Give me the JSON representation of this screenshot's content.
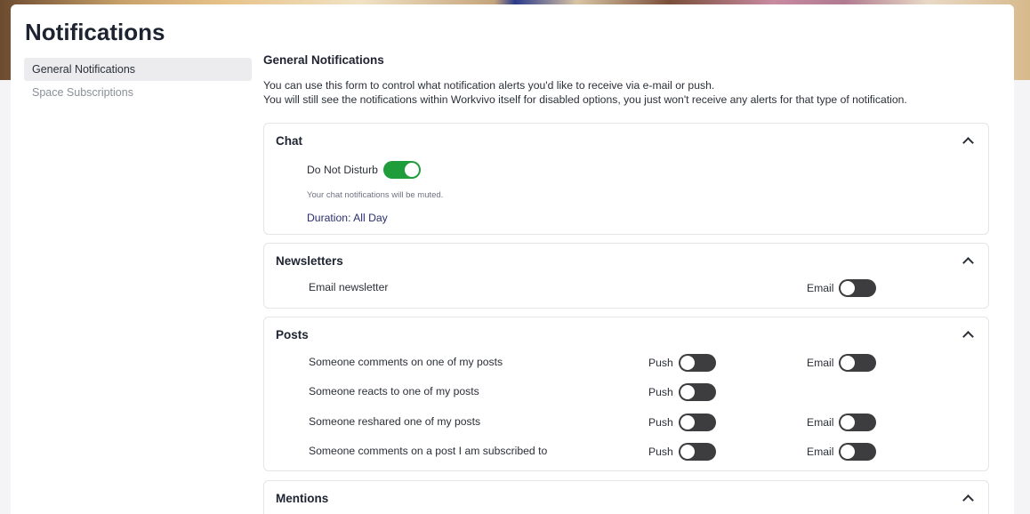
{
  "page": {
    "title": "Notifications"
  },
  "sidebar": {
    "items": [
      {
        "label": "General Notifications",
        "active": true
      },
      {
        "label": "Space Subscriptions",
        "active": false
      }
    ]
  },
  "main": {
    "heading": "General Notifications",
    "intro_line1": "You can use this form to control what notification alerts you'd like to receive via e-mail or push.",
    "intro_line2": "You will still see the notifications within Workvivo itself for disabled options, you just won't receive any alerts for that type of notification."
  },
  "chat": {
    "title": "Chat",
    "dnd_label": "Do Not Disturb",
    "dnd_enabled": true,
    "note": "Your chat notifications will be muted.",
    "duration": "Duration: All Day"
  },
  "newsletters": {
    "title": "Newsletters",
    "rows": [
      {
        "label": "Email newsletter",
        "email_label": "Email",
        "email_enabled": false
      }
    ]
  },
  "posts": {
    "title": "Posts",
    "push_label": "Push",
    "email_label": "Email",
    "rows": [
      {
        "label": "Someone comments on one of my posts",
        "push_enabled": false,
        "email_enabled": false
      },
      {
        "label": "Someone reacts to one of my posts",
        "push_enabled": false
      },
      {
        "label": "Someone reshared one of my posts",
        "push_enabled": false,
        "email_enabled": false
      },
      {
        "label": "Someone comments on a post I am subscribed to",
        "push_enabled": false,
        "email_enabled": false
      }
    ]
  },
  "mentions": {
    "title": "Mentions"
  },
  "colors": {
    "toggle_on": "#1f9d3a",
    "toggle_off": "#3d3d3f",
    "accent_text": "#2a2f6e"
  },
  "icons": {
    "collapse": "chevron-up-icon"
  }
}
